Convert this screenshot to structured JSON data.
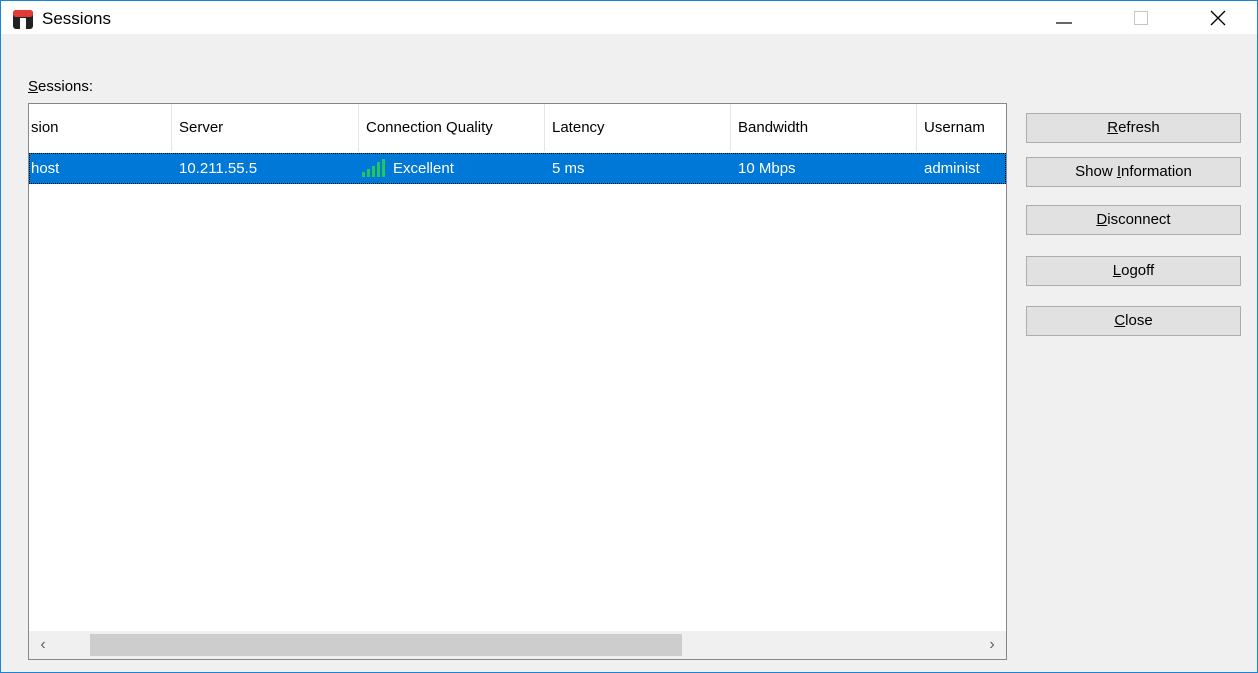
{
  "window": {
    "title": "Sessions",
    "icon": "app-icon"
  },
  "titlebar_buttons": {
    "minimize_icon": "minimize-icon",
    "maximize_icon": "maximize-icon",
    "close_icon": "close-icon"
  },
  "sessions_label": {
    "mnemonic": "S",
    "rest": "essions:"
  },
  "table": {
    "columns": [
      "sion",
      "Server",
      "Connection Quality",
      "Latency",
      "Bandwidth",
      "Usernam"
    ],
    "rows": [
      {
        "session": "host",
        "server": "10.211.55.5",
        "quality": "Excellent",
        "quality_icon": "signal-bars-icon",
        "latency": "5 ms",
        "bandwidth": "10 Mbps",
        "username": "administ"
      }
    ],
    "selected_row_color": "#0078d7",
    "signal_color": "#22c55e"
  },
  "scrollbar": {
    "left_arrow": "‹",
    "right_arrow": "›",
    "thumb_fraction": 0.63
  },
  "buttons": [
    {
      "pre": "",
      "mnemonic": "R",
      "post": "efresh"
    },
    {
      "pre": "Show ",
      "mnemonic": "I",
      "post": "nformation"
    },
    {
      "pre": "",
      "mnemonic": "D",
      "post": "isconnect"
    },
    {
      "pre": "",
      "mnemonic": "L",
      "post": "ogoff"
    },
    {
      "pre": "",
      "mnemonic": "C",
      "post": "lose"
    }
  ]
}
